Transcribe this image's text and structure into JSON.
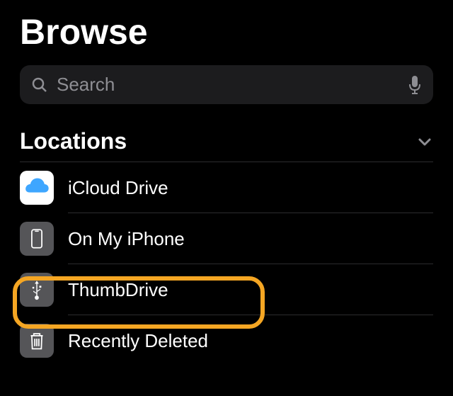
{
  "header": {
    "title": "Browse"
  },
  "search": {
    "placeholder": "Search"
  },
  "section": {
    "title": "Locations",
    "items": [
      {
        "label": "iCloud Drive"
      },
      {
        "label": "On My iPhone"
      },
      {
        "label": "ThumbDrive"
      },
      {
        "label": "Recently Deleted"
      }
    ]
  },
  "colors": {
    "highlight": "#f5a623",
    "icloud": "#3ea6ff"
  }
}
